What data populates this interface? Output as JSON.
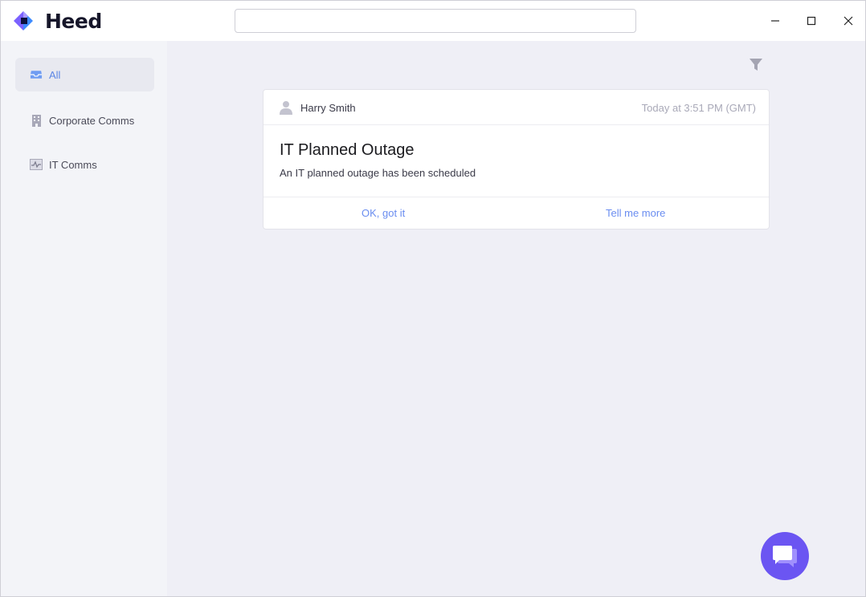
{
  "app": {
    "name": "Heed",
    "brand_color": "#6b55f2",
    "accent_color": "#5b86e5"
  },
  "search": {
    "placeholder": "",
    "value": ""
  },
  "window_controls": {
    "icons": [
      "minimize-icon",
      "maximize-icon",
      "close-icon"
    ]
  },
  "sidebar": {
    "items": [
      {
        "label": "All",
        "icon": "inbox-icon",
        "active": true
      },
      {
        "label": "Corporate Comms",
        "icon": "building-icon",
        "active": false
      },
      {
        "label": "IT Comms",
        "icon": "activity-icon",
        "active": false
      }
    ]
  },
  "main": {
    "filter_icon": "filter-icon",
    "cards": [
      {
        "sender": "Harry Smith",
        "timestamp": "Today at 3:51 PM (GMT)",
        "title": "IT Planned Outage",
        "body": "An IT planned outage has been scheduled",
        "actions": {
          "primary": "OK, got it",
          "secondary": "Tell me more"
        }
      }
    ],
    "chat_icon": "chat-icon"
  }
}
